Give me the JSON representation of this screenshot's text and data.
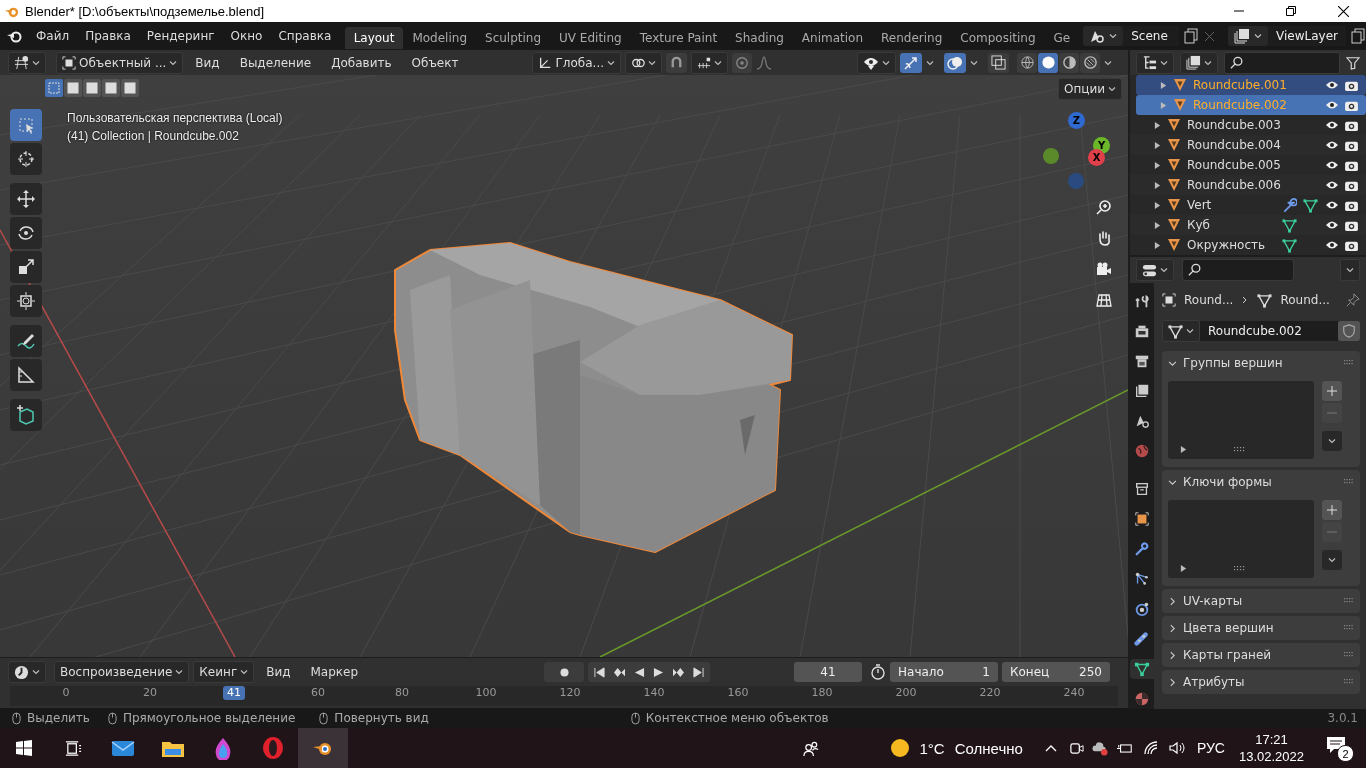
{
  "window": {
    "title": "Blender* [D:\\объекты\\подземелье.blend]"
  },
  "menu": [
    "Файл",
    "Правка",
    "Рендеринг",
    "Окно",
    "Справка"
  ],
  "workspaces": [
    {
      "label": "Layout",
      "selected": true
    },
    {
      "label": "Modeling",
      "selected": false
    },
    {
      "label": "Sculpting",
      "selected": false
    },
    {
      "label": "UV Editing",
      "selected": false
    },
    {
      "label": "Texture Paint",
      "selected": false
    },
    {
      "label": "Shading",
      "selected": false
    },
    {
      "label": "Animation",
      "selected": false
    },
    {
      "label": "Rendering",
      "selected": false
    },
    {
      "label": "Compositing",
      "selected": false
    },
    {
      "label": "Ge",
      "selected": false
    }
  ],
  "scene": "Scene",
  "view_layer": "ViewLayer",
  "viewport": {
    "mode": "Объектный ...",
    "menus": [
      "Вид",
      "Выделение",
      "Добавить",
      "Объект"
    ],
    "orientation": "Глоба...",
    "options": "Опции",
    "select_modes": [
      {
        "selected": true
      },
      {
        "selected": false
      },
      {
        "selected": false
      },
      {
        "selected": false
      },
      {
        "selected": false
      }
    ],
    "gizmo_on": true,
    "overlays_on": true,
    "shading": [
      {
        "kind": "wire",
        "selected": false
      },
      {
        "kind": "solid",
        "selected": true
      },
      {
        "kind": "material",
        "selected": false
      },
      {
        "kind": "rendered",
        "selected": false
      }
    ],
    "info": [
      "Пользовательская перспектива (Local)",
      "(41) Collection | Roundcube.002"
    ],
    "tools": [
      {
        "kind": "select",
        "selected": true
      },
      {
        "kind": "cursor",
        "selected": false
      },
      {
        "kind": "move",
        "selected": false
      },
      {
        "kind": "rotate",
        "selected": false
      },
      {
        "kind": "scale",
        "selected": false
      },
      {
        "kind": "transform",
        "selected": false
      },
      {
        "kind": "annotate",
        "selected": false
      },
      {
        "kind": "measure",
        "selected": false
      },
      {
        "kind": "add-cube",
        "selected": false
      }
    ],
    "axes": [
      "Z",
      "Y",
      "X"
    ]
  },
  "outliner": {
    "items": [
      {
        "name": "Roundcube.001",
        "selected": true,
        "active": false,
        "modifier": false,
        "mesh": false
      },
      {
        "name": "Roundcube.002",
        "selected": true,
        "active": true,
        "modifier": false,
        "mesh": false
      },
      {
        "name": "Roundcube.003",
        "selected": false,
        "active": false,
        "modifier": false,
        "mesh": false
      },
      {
        "name": "Roundcube.004",
        "selected": false,
        "active": false,
        "modifier": false,
        "mesh": false
      },
      {
        "name": "Roundcube.005",
        "selected": false,
        "active": false,
        "modifier": false,
        "mesh": false
      },
      {
        "name": "Roundcube.006",
        "selected": false,
        "active": false,
        "modifier": false,
        "mesh": false
      },
      {
        "name": "Vert",
        "selected": false,
        "active": false,
        "modifier": true,
        "mesh": true
      },
      {
        "name": "Куб",
        "selected": false,
        "active": false,
        "modifier": false,
        "mesh": true
      },
      {
        "name": "Окружность",
        "selected": false,
        "active": false,
        "modifier": false,
        "mesh": true
      }
    ]
  },
  "properties": {
    "tabs": [
      {
        "kind": "tool",
        "selected": false
      },
      {
        "kind": "render",
        "selected": false
      },
      {
        "kind": "output",
        "selected": false
      },
      {
        "kind": "view-layer",
        "selected": false
      },
      {
        "kind": "scene",
        "selected": false
      },
      {
        "kind": "world",
        "selected": false
      },
      {
        "kind": "collection",
        "selected": false
      },
      {
        "kind": "object",
        "selected": false
      },
      {
        "kind": "modifier",
        "selected": false
      },
      {
        "kind": "particles",
        "selected": false
      },
      {
        "kind": "physics",
        "selected": false
      },
      {
        "kind": "constraints",
        "selected": false
      },
      {
        "kind": "data",
        "selected": true
      },
      {
        "kind": "material",
        "selected": false
      }
    ],
    "breadcrumb": [
      "Round...",
      "Round..."
    ],
    "data_name": "Roundcube.002",
    "panels": [
      {
        "title": "Группы вершин",
        "expanded": true
      },
      {
        "title": "Ключи формы",
        "expanded": true
      },
      {
        "title": "UV-карты",
        "expanded": false
      },
      {
        "title": "Цвета вершин",
        "expanded": false
      },
      {
        "title": "Карты граней",
        "expanded": false
      },
      {
        "title": "Атрибуты",
        "expanded": false
      }
    ]
  },
  "timeline": {
    "menus": [
      "Воспроизведение",
      "Кеинг",
      "Вид",
      "Маркер"
    ],
    "current_frame": "41",
    "start_label": "Начало",
    "start": "1",
    "end_label": "Конец",
    "end": "250",
    "playhead": "41",
    "ruler": [
      "0",
      "20",
      "60",
      "80",
      "100",
      "120",
      "140",
      "160",
      "180",
      "200",
      "220",
      "240"
    ]
  },
  "status_bar": {
    "hints": [
      "Выделить",
      "Прямоугольное выделение",
      "Повернуть вид",
      "Контекстное меню объектов"
    ],
    "version": "3.0.1"
  },
  "taskbar": {
    "apps": [
      {
        "kind": "mail",
        "selected": false
      },
      {
        "kind": "files",
        "selected": false
      },
      {
        "kind": "drop",
        "selected": false
      },
      {
        "kind": "opera",
        "selected": false
      },
      {
        "kind": "blender",
        "selected": true
      }
    ],
    "temperature": "1°C",
    "weather": "Солнечно",
    "language": "РУС",
    "time": "17:21",
    "date": "13.02.2022",
    "notifications": "2"
  }
}
